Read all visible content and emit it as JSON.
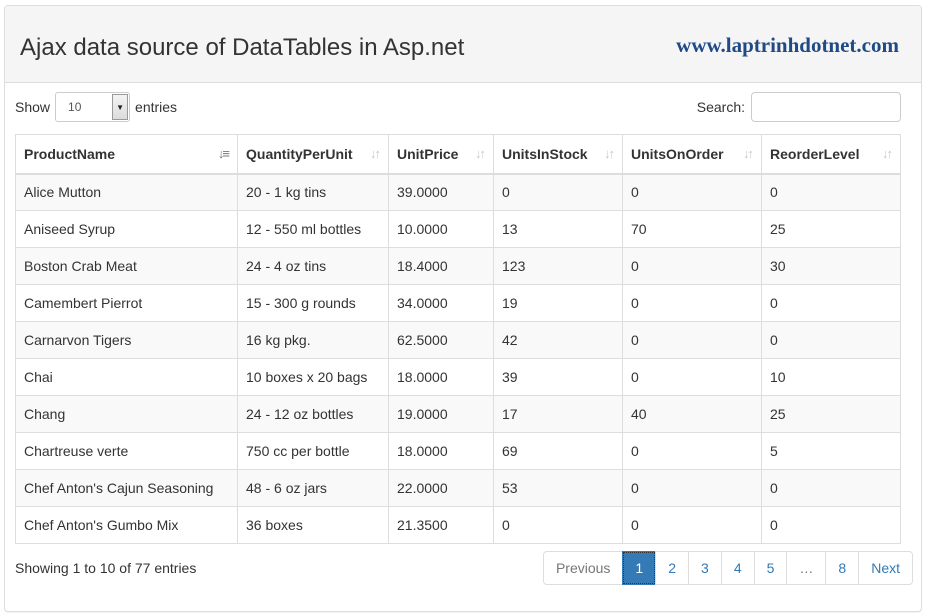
{
  "header": {
    "title": "Ajax data source of DataTables in Asp.net",
    "brand": "www.laptrinhdotnet.com"
  },
  "controls": {
    "show_label": "Show",
    "entries_value": "10",
    "entries_label": "entries",
    "search_label": "Search:",
    "search_value": ""
  },
  "table": {
    "columns": [
      "ProductName",
      "QuantityPerUnit",
      "UnitPrice",
      "UnitsInStock",
      "UnitsOnOrder",
      "ReorderLevel"
    ],
    "rows": [
      [
        "Alice Mutton",
        "20 - 1 kg tins",
        "39.0000",
        "0",
        "0",
        "0"
      ],
      [
        "Aniseed Syrup",
        "12 - 550 ml bottles",
        "10.0000",
        "13",
        "70",
        "25"
      ],
      [
        "Boston Crab Meat",
        "24 - 4 oz tins",
        "18.4000",
        "123",
        "0",
        "30"
      ],
      [
        "Camembert Pierrot",
        "15 - 300 g rounds",
        "34.0000",
        "19",
        "0",
        "0"
      ],
      [
        "Carnarvon Tigers",
        "16 kg pkg.",
        "62.5000",
        "42",
        "0",
        "0"
      ],
      [
        "Chai",
        "10 boxes x 20 bags",
        "18.0000",
        "39",
        "0",
        "10"
      ],
      [
        "Chang",
        "24 - 12 oz bottles",
        "19.0000",
        "17",
        "40",
        "25"
      ],
      [
        "Chartreuse verte",
        "750 cc per bottle",
        "18.0000",
        "69",
        "0",
        "5"
      ],
      [
        "Chef Anton's Cajun Seasoning",
        "48 - 6 oz jars",
        "22.0000",
        "53",
        "0",
        "0"
      ],
      [
        "Chef Anton's Gumbo Mix",
        "36 boxes",
        "21.3500",
        "0",
        "0",
        "0"
      ]
    ]
  },
  "footer": {
    "info": "Showing 1 to 10 of 77 entries",
    "pages": [
      "Previous",
      "1",
      "2",
      "3",
      "4",
      "5",
      "…",
      "8",
      "Next"
    ]
  },
  "colors": {
    "brand": "#1f4a86",
    "link": "#337ab7"
  }
}
